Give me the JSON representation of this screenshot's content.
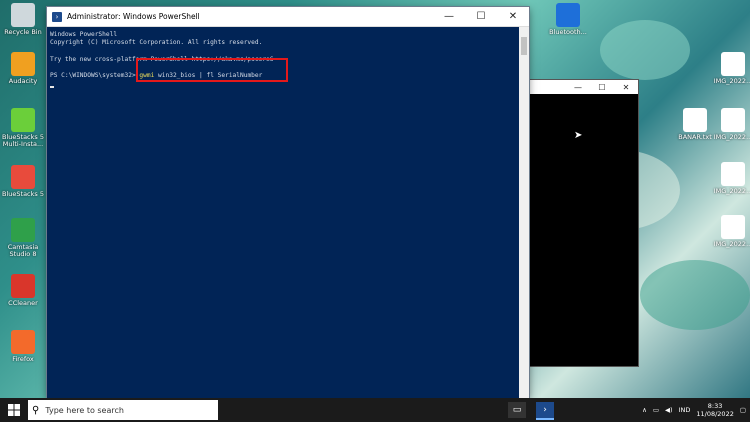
{
  "desktop_icons_left": [
    {
      "label": "Recycle Bin",
      "color": "#cfd8dc"
    },
    {
      "label": "Audacity",
      "color": "#f0a020"
    },
    {
      "label": "BlueStacks 5 Multi-Insta...",
      "color": "#6bcf3a"
    },
    {
      "label": "BlueStacks 5",
      "color": "#e84b3c"
    },
    {
      "label": "Camtasia Studio 8",
      "color": "#2fa04a"
    },
    {
      "label": "CCleaner",
      "color": "#d9362b"
    },
    {
      "label": "Firefox",
      "color": "#f36a2b"
    }
  ],
  "desktop_icons_right": [
    {
      "label": "Bluetooth...",
      "color": "#1e6fd9"
    },
    {
      "label": "IMG_2022...",
      "color": "#ffffff"
    },
    {
      "label": "IMG_2022...",
      "color": "#ffffff"
    },
    {
      "label": "BANAR.txt",
      "color": "#ffffff"
    },
    {
      "label": "IMG_2022...",
      "color": "#ffffff"
    },
    {
      "label": "IMG_2022...",
      "color": "#ffffff"
    }
  ],
  "ps_window": {
    "title": "Administrator: Windows PowerShell",
    "line1": "Windows PowerShell",
    "line2": "Copyright (C) Microsoft Corporation. All rights reserved.",
    "line3": "Try the new cross-platform PowerShell https://aka.ms/pscore6",
    "prompt": "PS C:\\WINDOWS\\system32> ",
    "cmd": "gwmi",
    "args": " win32_bios | fl SerialNumber",
    "minimize": "—",
    "maximize": "☐",
    "close": "✕"
  },
  "black_window": {
    "minimize": "—",
    "maximize": "☐",
    "close": "✕"
  },
  "taskbar": {
    "search_placeholder": "Type here to search",
    "language": "IND",
    "time": "8:33",
    "date": "11/08/2022"
  },
  "colors": {
    "ps_background": "#012456",
    "highlight": "#e3191b",
    "cmd_yellow": "#f0e05a"
  }
}
